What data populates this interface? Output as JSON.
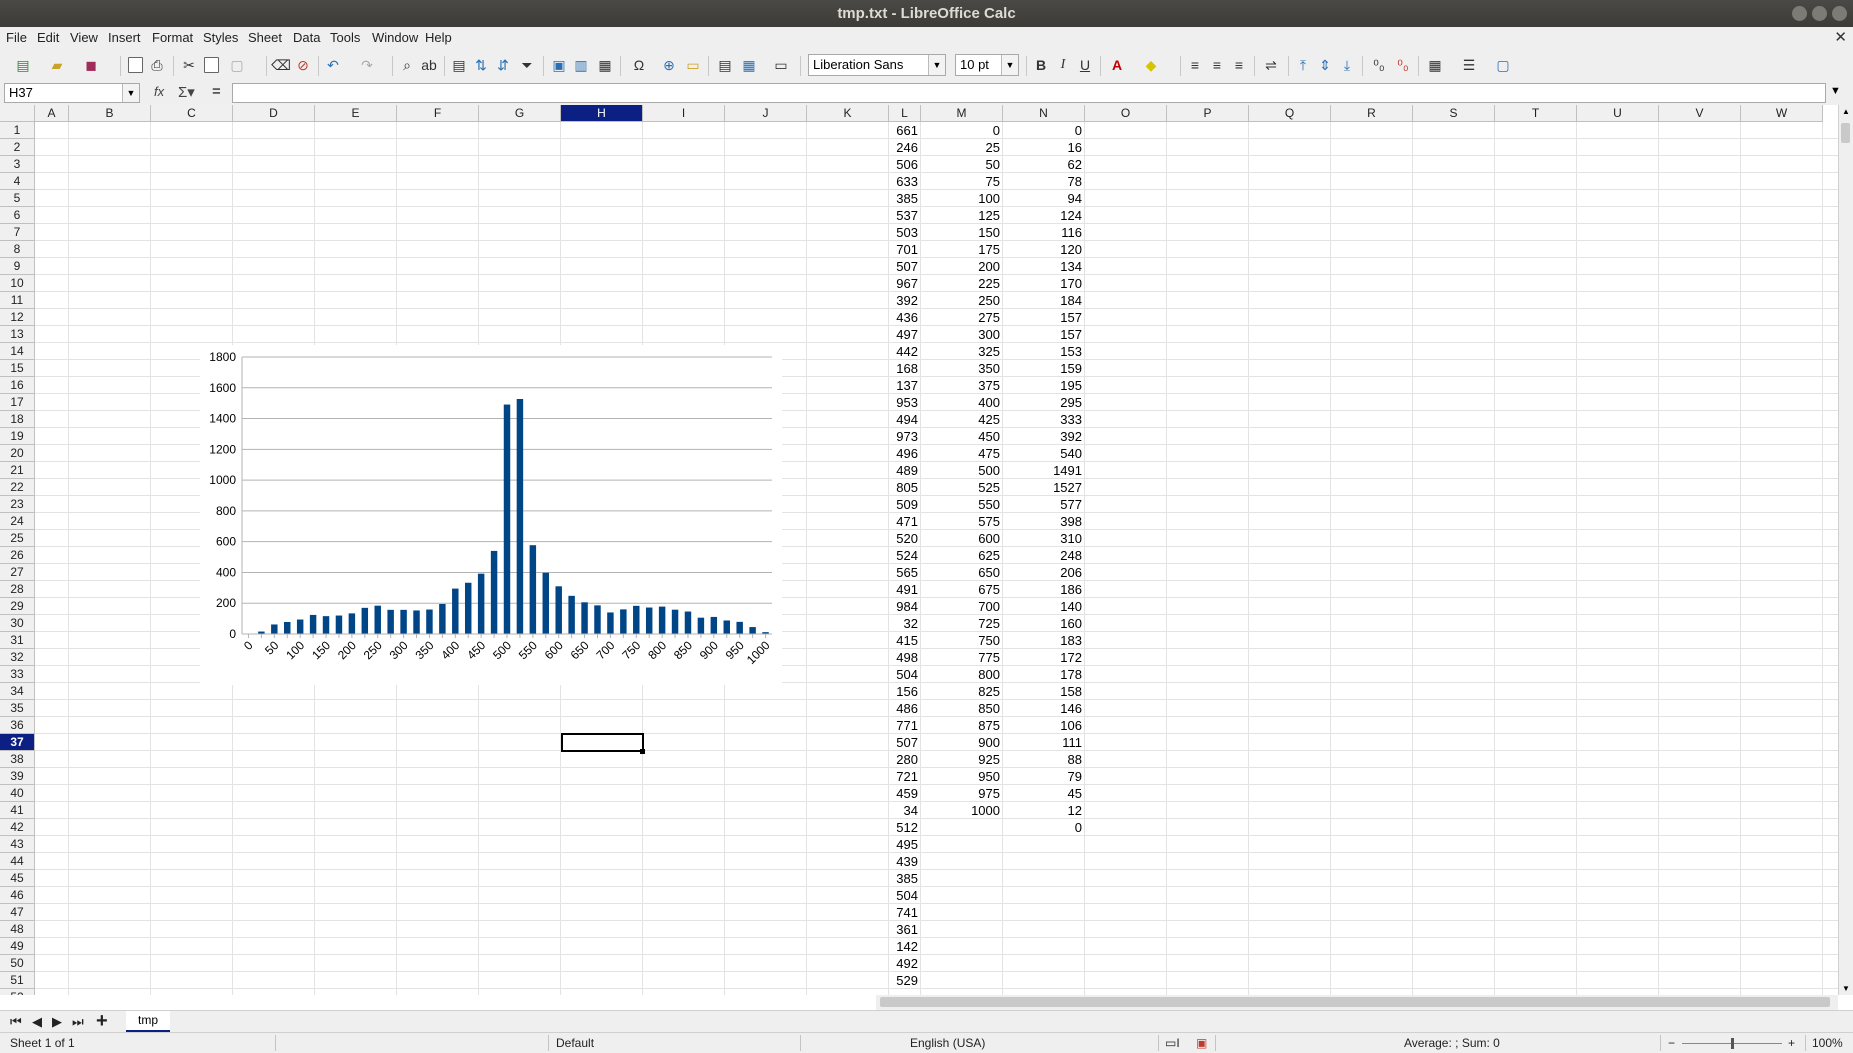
{
  "window": {
    "title": "tmp.txt - LibreOffice Calc"
  },
  "menu": [
    "File",
    "Edit",
    "View",
    "Insert",
    "Format",
    "Styles",
    "Sheet",
    "Data",
    "Tools",
    "Window",
    "Help"
  ],
  "toolbar": {
    "font_name": "Liberation Sans",
    "font_size": "10 pt"
  },
  "formula_bar": {
    "name_box": "H37",
    "equals": "=",
    "content": ""
  },
  "columns": [
    "A",
    "B",
    "C",
    "D",
    "E",
    "F",
    "G",
    "H",
    "I",
    "J",
    "K",
    "L",
    "M",
    "N",
    "O",
    "P",
    "Q",
    "R",
    "S",
    "T",
    "U",
    "V",
    "W"
  ],
  "selected_column": "H",
  "selected_row": 37,
  "rows_visible": 51,
  "col_L": [
    661,
    246,
    506,
    633,
    385,
    537,
    503,
    701,
    507,
    967,
    392,
    436,
    497,
    442,
    168,
    137,
    953,
    494,
    973,
    496,
    489,
    805,
    509,
    471,
    520,
    524,
    565,
    491,
    984,
    32,
    415,
    498,
    504,
    156,
    486,
    771,
    507,
    280,
    721,
    459,
    34,
    512,
    495,
    439,
    385,
    504,
    741,
    361,
    142,
    492,
    529
  ],
  "col_M": [
    0,
    25,
    50,
    75,
    100,
    125,
    150,
    175,
    200,
    225,
    250,
    275,
    300,
    325,
    350,
    375,
    400,
    425,
    450,
    475,
    500,
    525,
    550,
    575,
    600,
    625,
    650,
    675,
    700,
    725,
    750,
    775,
    800,
    825,
    850,
    875,
    900,
    925,
    950,
    975,
    1000
  ],
  "col_N": [
    0,
    16,
    62,
    78,
    94,
    124,
    116,
    120,
    134,
    170,
    184,
    157,
    157,
    153,
    159,
    195,
    295,
    333,
    392,
    540,
    1491,
    1527,
    577,
    398,
    310,
    248,
    206,
    186,
    140,
    160,
    183,
    172,
    178,
    158,
    146,
    106,
    111,
    88,
    79,
    45,
    12,
    0
  ],
  "chart_data": {
    "type": "bar",
    "categories": [
      0,
      25,
      50,
      75,
      100,
      125,
      150,
      175,
      200,
      225,
      250,
      275,
      300,
      325,
      350,
      375,
      400,
      425,
      450,
      475,
      500,
      525,
      550,
      575,
      600,
      625,
      650,
      675,
      700,
      725,
      750,
      775,
      800,
      825,
      850,
      875,
      900,
      925,
      950,
      975,
      1000
    ],
    "values": [
      0,
      16,
      62,
      78,
      94,
      124,
      116,
      120,
      134,
      170,
      184,
      157,
      157,
      153,
      159,
      195,
      295,
      333,
      392,
      540,
      1491,
      1527,
      577,
      398,
      310,
      248,
      206,
      186,
      140,
      160,
      183,
      172,
      178,
      158,
      146,
      106,
      111,
      88,
      79,
      45,
      12
    ],
    "ylim": [
      0,
      1800
    ],
    "yticks": [
      0,
      200,
      400,
      600,
      800,
      1000,
      1200,
      1400,
      1600,
      1800
    ],
    "xtick_labels": [
      "0",
      "50",
      "100",
      "150",
      "200",
      "250",
      "300",
      "350",
      "400",
      "450",
      "500",
      "550",
      "600",
      "650",
      "700",
      "750",
      "800",
      "850",
      "900",
      "950",
      "1000"
    ],
    "bar_color": "#004586",
    "grid": true
  },
  "sheet_tab": "tmp",
  "status": {
    "sheet": "Sheet 1 of 1",
    "style": "Default",
    "language": "English (USA)",
    "summary": "Average: ; Sum: 0",
    "zoom": "100%"
  }
}
